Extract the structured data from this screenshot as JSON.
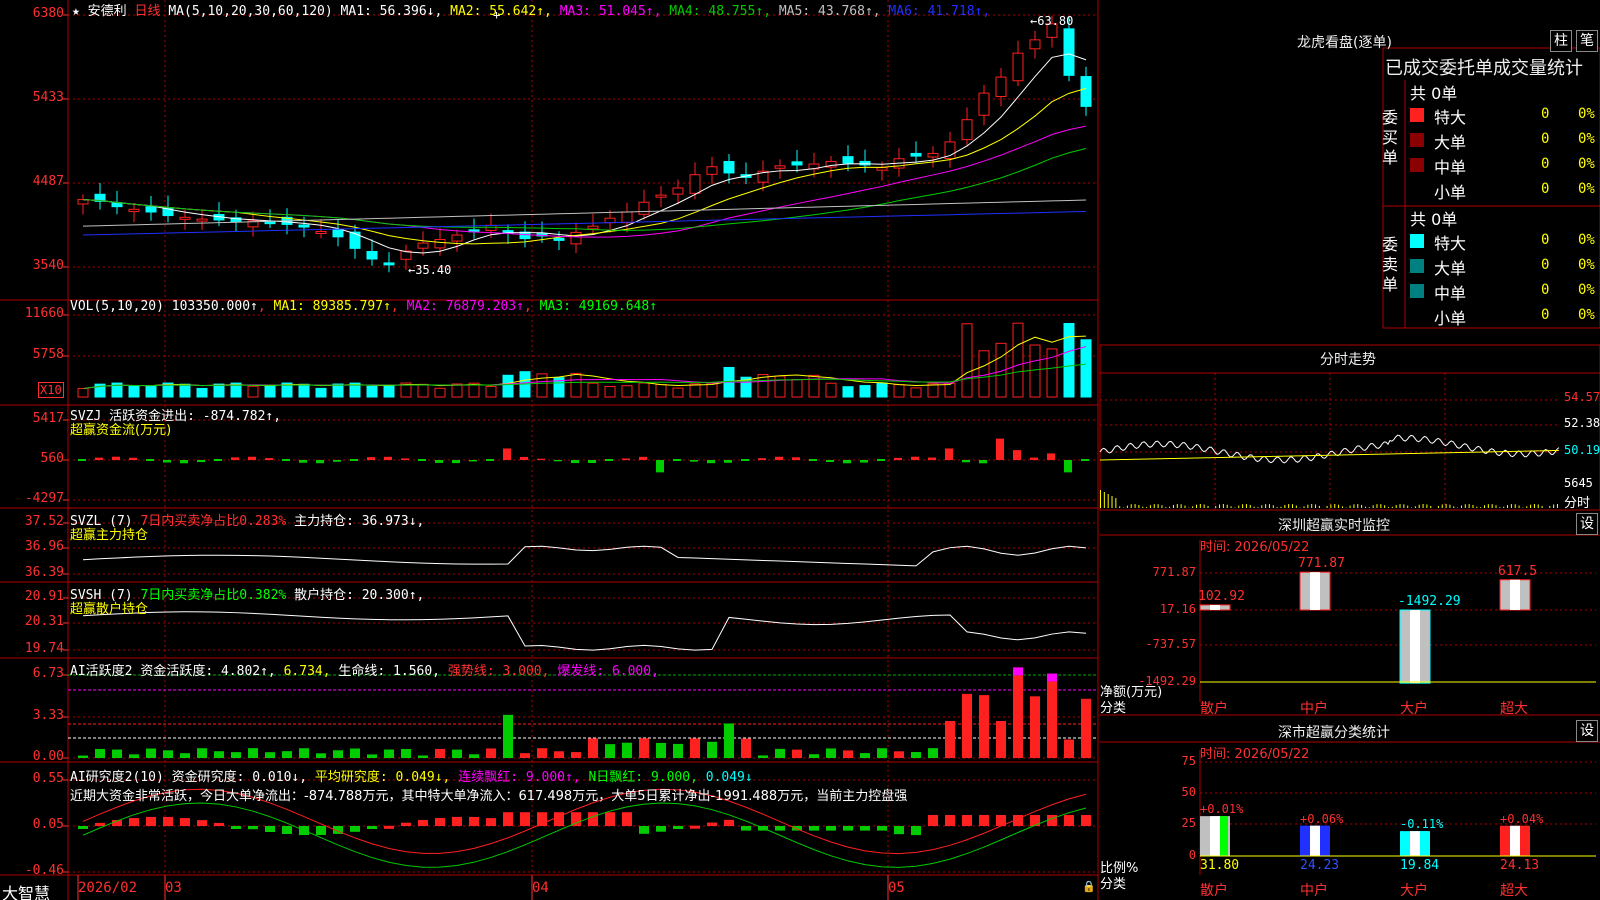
{
  "colors": {
    "up": "#ff2020",
    "down": "#00ffff",
    "grid": "#b00000",
    "ma1": "#ffffff",
    "ma2": "#ffff00",
    "ma3": "#ff00ff",
    "ma4": "#00cc00",
    "ma5": "#c0c0c0",
    "ma6": "#2030ff"
  },
  "main": {
    "stock_name": "安德利",
    "period": "日线",
    "ma_def": "MA(5,10,20,30,60,120)",
    "ma": [
      {
        "label": "MA1:",
        "value": "56.396↓",
        "color": "#ffffff"
      },
      {
        "label": "MA2:",
        "value": "55.642↑",
        "color": "#ffff00"
      },
      {
        "label": "MA3:",
        "value": "51.045↑",
        "color": "#ff00ff"
      },
      {
        "label": "MA4:",
        "value": "48.755↑",
        "color": "#00cc00"
      },
      {
        "label": "MA5:",
        "value": "43.768↑",
        "color": "#c0c0c0"
      },
      {
        "label": "MA6:",
        "value": "41.718↑",
        "color": "#2030ff"
      }
    ],
    "yticks": [
      "6380",
      "5433",
      "4487",
      "3540"
    ],
    "high_label": "63.80",
    "low_label": "35.40"
  },
  "vol": {
    "title": "VOL(5,10,20)",
    "value": "103350.000↑",
    "ma1": "MA1: 89385.797↑",
    "ma2": "MA2: 76879.203↑",
    "ma3": "MA3: 49169.648↑",
    "yticks": [
      "11660",
      "5758"
    ],
    "unit": "X10"
  },
  "svzj": {
    "title": "SVZJ",
    "desc": "活跃资金进出: -874.782↑,",
    "sub": "超赢资金流(万元)",
    "yticks": [
      "5417",
      "560",
      "-4297"
    ]
  },
  "svzl": {
    "title": "SVZL (7)",
    "ratio": "7日内买卖净占比0.283%",
    "hold": "主力持仓: 36.973↓,",
    "sub": "超赢主力持仓",
    "yticks": [
      "37.52",
      "36.96",
      "36.39"
    ]
  },
  "svsh": {
    "title": "SVSH (7)",
    "ratio": "7日内买卖净占比0.382%",
    "hold": "散户持仓: 20.300↑,",
    "sub": "超赢散户持仓",
    "yticks": [
      "20.91",
      "20.31",
      "19.74"
    ]
  },
  "ai_act": {
    "title": "AI活跃度2",
    "a": "资金活跃度: 4.802↑,",
    "b": "6.734,",
    "c": "生命线: 1.560,",
    "d": "强势线: 3.000,",
    "e": "爆发线: 6.000,",
    "yticks": [
      "6.73",
      "3.33",
      "0.00"
    ]
  },
  "ai_res": {
    "title": "AI研究度2(10)",
    "a": "资金研究度: 0.010↓,",
    "b": "平均研究度: 0.049↓,",
    "c": "连续飘红: 9.000↑,",
    "d": "N日飘红: 9.000,",
    "e": "0.049↓",
    "note": "近期大资金非常活跃，今日大单净流出：-874.788万元，其中特大单净流入：617.498万元，大单5日累计净出-1991.488万元，当前主力控盘强",
    "yticks": [
      "0.55",
      "0.05",
      "-0.46"
    ]
  },
  "bottom": {
    "brand": "大智慧",
    "dates": [
      "2026/02",
      "03",
      "04",
      "05"
    ]
  },
  "longhu": {
    "title": "龙虎看盘(逐单)",
    "btn1": "柱",
    "btn2": "笔",
    "header": "已成交委托单成交量统计",
    "buy_label": "委买单",
    "sell_label": "委卖单",
    "buy_total": "共 0单",
    "sell_total": "共 0单",
    "buy": [
      {
        "name": "特大",
        "count": "0",
        "pct": "0%"
      },
      {
        "name": "大单",
        "count": "0",
        "pct": "0%"
      },
      {
        "name": "中单",
        "count": "0",
        "pct": "0%"
      },
      {
        "name": "小单",
        "count": "0",
        "pct": "0%"
      }
    ],
    "sell": [
      {
        "name": "特大",
        "count": "0",
        "pct": "0%"
      },
      {
        "name": "大单",
        "count": "0",
        "pct": "0%"
      },
      {
        "name": "中单",
        "count": "0",
        "pct": "0%"
      },
      {
        "name": "小单",
        "count": "0",
        "pct": "0%"
      }
    ]
  },
  "fenshi": {
    "title": "分时走势",
    "yticks": [
      "54.57",
      "52.38",
      "50.19"
    ],
    "vol_label": "5645",
    "unit": "分时"
  },
  "monitor": {
    "title": "深圳超赢实时监控",
    "btn": "设",
    "time": "时间: 2026/05/22",
    "yticks": [
      "771.87",
      "17.16",
      "-737.57",
      "-1492.29"
    ],
    "ylabel": "净额(万元)",
    "xlabel": "分类",
    "values": [
      {
        "label": "102.92"
      },
      {
        "label": "771.87"
      },
      {
        "label": "-1492.29"
      },
      {
        "label": "617.5"
      }
    ],
    "cats": [
      "散户",
      "中户",
      "大户",
      "超大"
    ]
  },
  "classify": {
    "title": "深市超赢分类统计",
    "btn": "设",
    "time": "时间: 2026/05/22",
    "yticks": [
      "75",
      "50",
      "25",
      "0"
    ],
    "ylabel": "比例%",
    "xlabel": "分类",
    "pcts": [
      "+0.01%",
      "+0.06%",
      "-0.11%",
      "+0.04%"
    ],
    "vals": [
      "31.80",
      "24.23",
      "19.84",
      "24.13"
    ],
    "cats": [
      "散户",
      "中户",
      "大户",
      "超大"
    ]
  }
}
